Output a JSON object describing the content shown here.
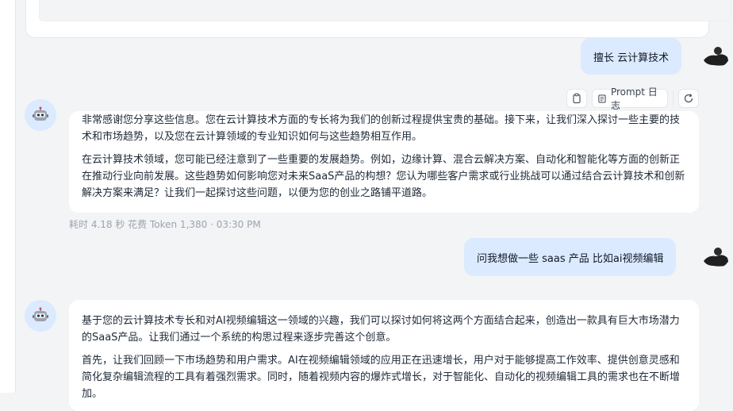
{
  "messages": {
    "user1": "擅长 云计算技术",
    "bot1": {
      "p1": "非常感谢您分享这些信息。您在云计算技术方面的专长将为我们的创新过程提供宝贵的基础。接下来，让我们深入探讨一些主要的技术和市场趋势，以及您在云计算领域的专业知识如何与这些趋势相互作用。",
      "p2": "在云计算技术领域，您可能已经注意到了一些重要的发展趋势。例如，边缘计算、混合云解决方案、自动化和智能化等方面的创新正在推动行业向前发展。这些趋势如何影响您对未来SaaS产品的构想？您认为哪些客户需求或行业挑战可以通过结合云计算技术和创新解决方案来满足？让我们一起探讨这些问题，以便为您的创业之路铺平道路。"
    },
    "meta1": "耗时 4.18 秒  花费 Token 1,380  ·  03:30 PM",
    "user2": "问我想做一些 saas 产品 比如ai视频编辑",
    "bot2": {
      "p1": "基于您的云计算技术专长和对AI视频编辑这一领域的兴趣，我们可以探讨如何将这两个方面结合起来，创造出一款具有巨大市场潜力的SaaS产品。让我们通过一个系统的构思过程来逐步完善这个创意。",
      "p2": "首先，让我们回顾一下市场趋势和用户需求。AI在视频编辑领域的应用正在迅速增长，用户对于能够提高工作效率、提供创意灵感和简化复杂编辑流程的工具有着强烈需求。同时，随着视频内容的爆炸式增长，对于智能化、自动化的视频编辑工具的需求也在不断增加。"
    }
  },
  "toolbar": {
    "prompt_log_label": "Prompt 日志"
  },
  "icons": {
    "copy": "clipboard-icon",
    "prompt_log": "document-icon",
    "regenerate": "refresh-icon",
    "bot_avatar": "robot-icon"
  }
}
